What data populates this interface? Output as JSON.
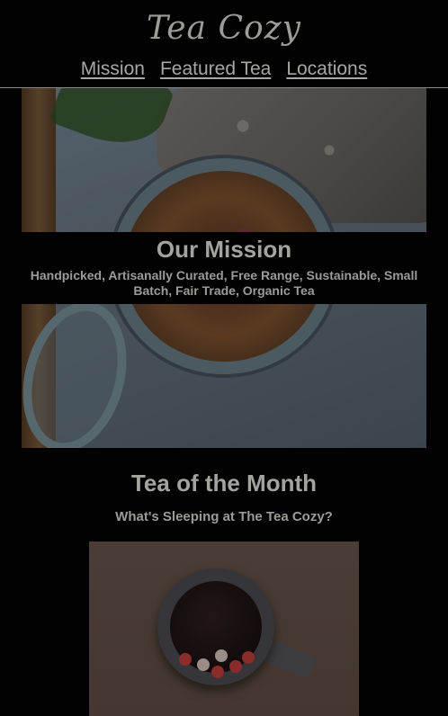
{
  "header": {
    "logo": "Tea Cozy",
    "nav": [
      "Mission",
      "Featured Tea",
      "Locations"
    ]
  },
  "mission": {
    "title": "Our Mission",
    "text": "Handpicked, Artisanally Curated, Free Range, Sustainable, Small Batch, Fair Trade, Organic Tea"
  },
  "tea_of_month": {
    "title": "Tea of the Month",
    "subtitle": "What's Sleeping at The Tea Cozy?"
  },
  "colors": {
    "background": "#020202",
    "text": "#a3a3a0",
    "divider": "#8a8a84"
  }
}
